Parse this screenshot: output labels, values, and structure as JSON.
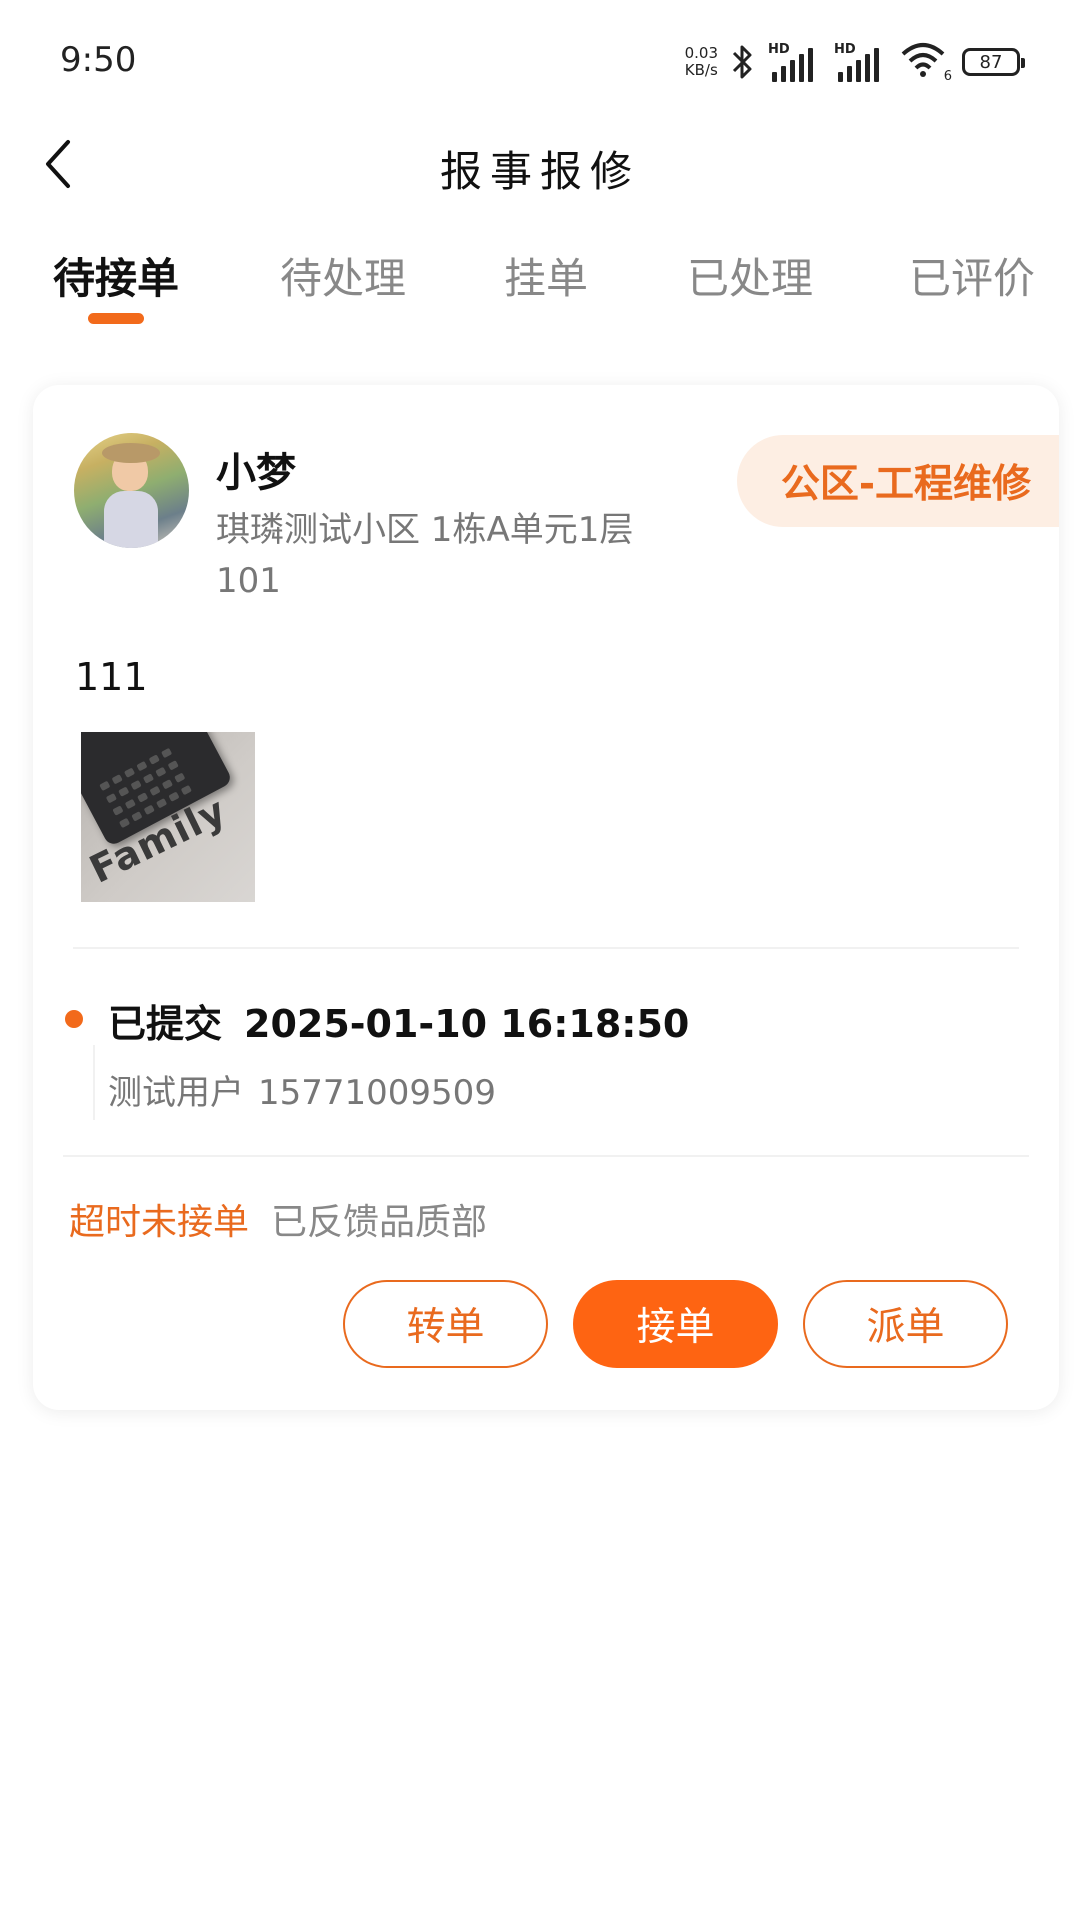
{
  "status_bar": {
    "time": "9:50",
    "net_speed_value": "0.03",
    "net_speed_unit": "KB/s",
    "signal_label_1": "HD",
    "signal_label_2": "HD",
    "wifi_label": "6",
    "battery": "87",
    "icons": [
      "bluetooth-icon",
      "signal-icon",
      "signal-icon",
      "wifi-icon",
      "battery-icon"
    ]
  },
  "header": {
    "title": "报事报修",
    "back_icon": "back-arrow-icon"
  },
  "tabs": [
    {
      "label": "待接单",
      "active": true
    },
    {
      "label": "待处理",
      "active": false
    },
    {
      "label": "挂单",
      "active": false
    },
    {
      "label": "已处理",
      "active": false
    },
    {
      "label": "已评价",
      "active": false
    }
  ],
  "accent_color": "#f26a1b",
  "order": {
    "user_name": "小梦",
    "address": "琪璘测试小区 1栋A单元1层101",
    "category": "公区-工程维修",
    "description": "111",
    "attachment_text": "Family",
    "timeline": {
      "status": "已提交",
      "time": "2025-01-10 16:18:50",
      "user": "测试用户",
      "phone": "15771009509"
    },
    "overdue": "超时未接单",
    "feedback": "已反馈品质部",
    "actions": {
      "transfer": "转单",
      "accept": "接单",
      "dispatch": "派单"
    }
  }
}
